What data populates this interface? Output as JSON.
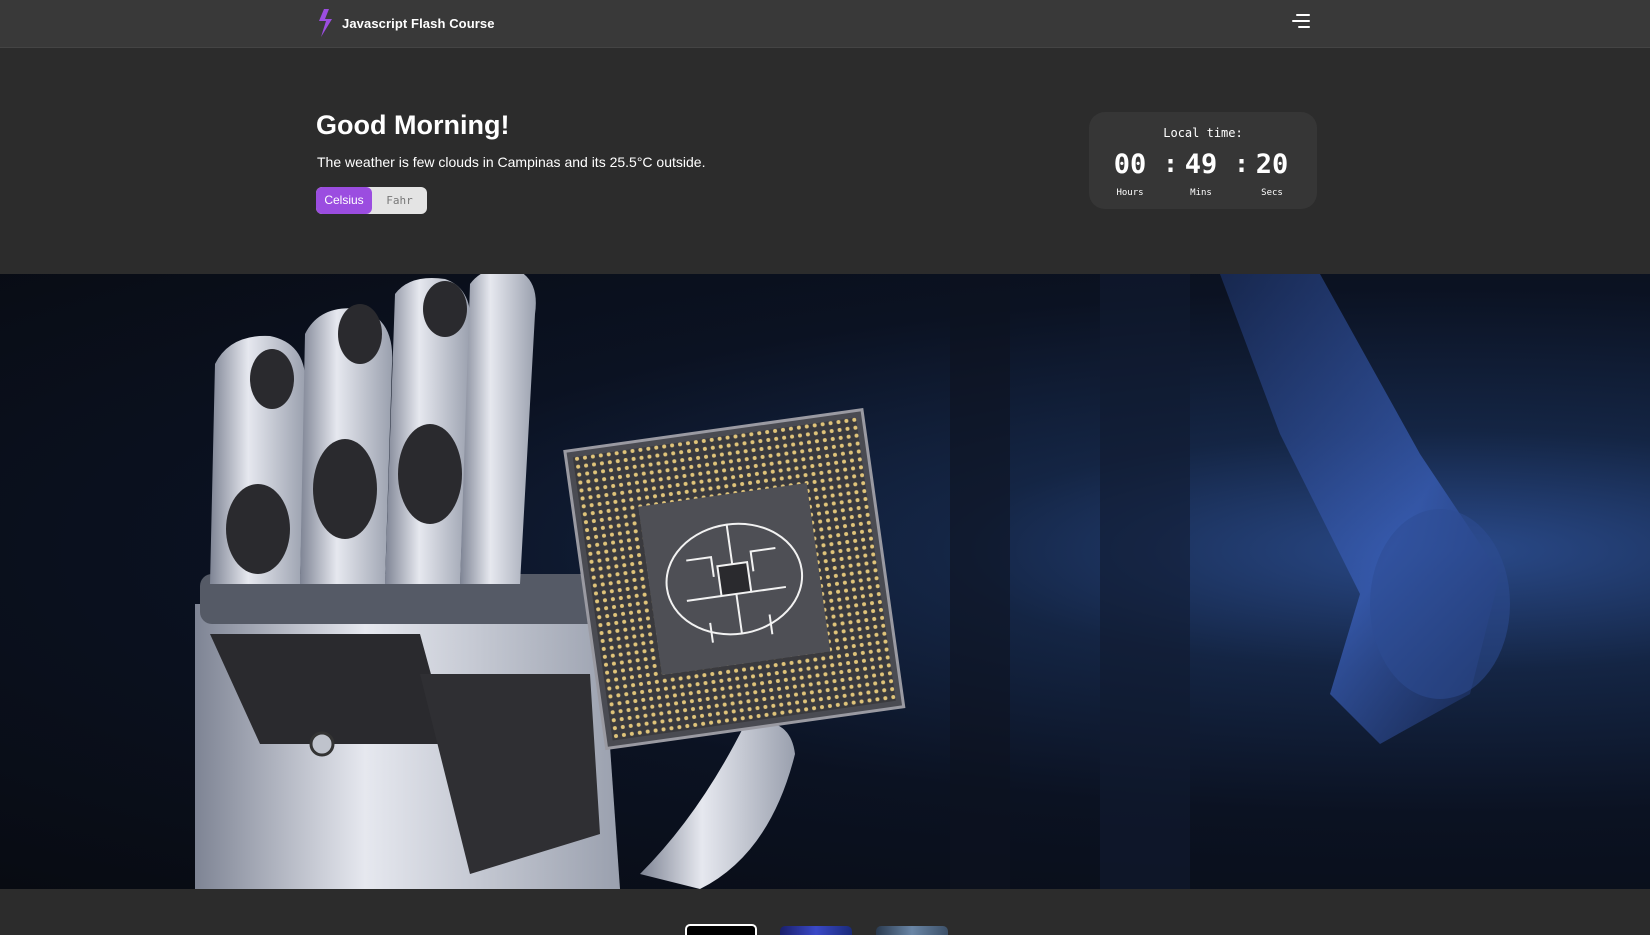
{
  "app": {
    "title": "Javascript Flash Course",
    "brand_color": "#9b4de0"
  },
  "navbar": {
    "menu_icon": "hamburger-menu-icon",
    "logo_icon": "lightning-bolt-icon"
  },
  "hero": {
    "greeting": "Good Morning!",
    "weather_text": "The weather is few clouds in Campinas and its 25.5°C outside.",
    "toggle": {
      "celsius_label": "Celsius",
      "fahr_label": "Fahr",
      "selected": "Celsius"
    }
  },
  "clock": {
    "label": "Local time:",
    "hours": "00",
    "minutes": "49",
    "seconds": "20",
    "separator": ":",
    "hours_label": "Hours",
    "minutes_label": "Mins",
    "seconds_label": "Secs"
  },
  "banner": {
    "image": "robot-hand-holding-brain-chip"
  },
  "carousel": {
    "thumbnails": 3,
    "active_index": 0
  }
}
